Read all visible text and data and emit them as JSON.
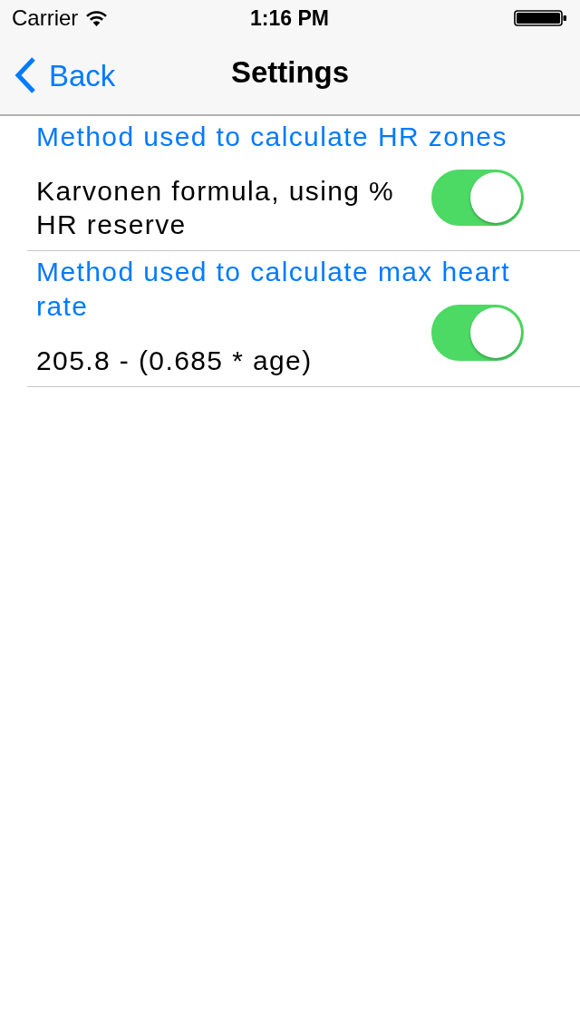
{
  "status_bar": {
    "carrier": "Carrier",
    "time": "1:16 PM"
  },
  "nav_bar": {
    "back": "Back",
    "title": "Settings"
  },
  "settings": [
    {
      "heading": "Method used to calculate HR zones",
      "value": "Karvonen formula, using % HR reserve",
      "on": true
    },
    {
      "heading": "Method used to calculate max heart rate",
      "value": "205.8 - (0.685 * age)",
      "on": true
    }
  ]
}
